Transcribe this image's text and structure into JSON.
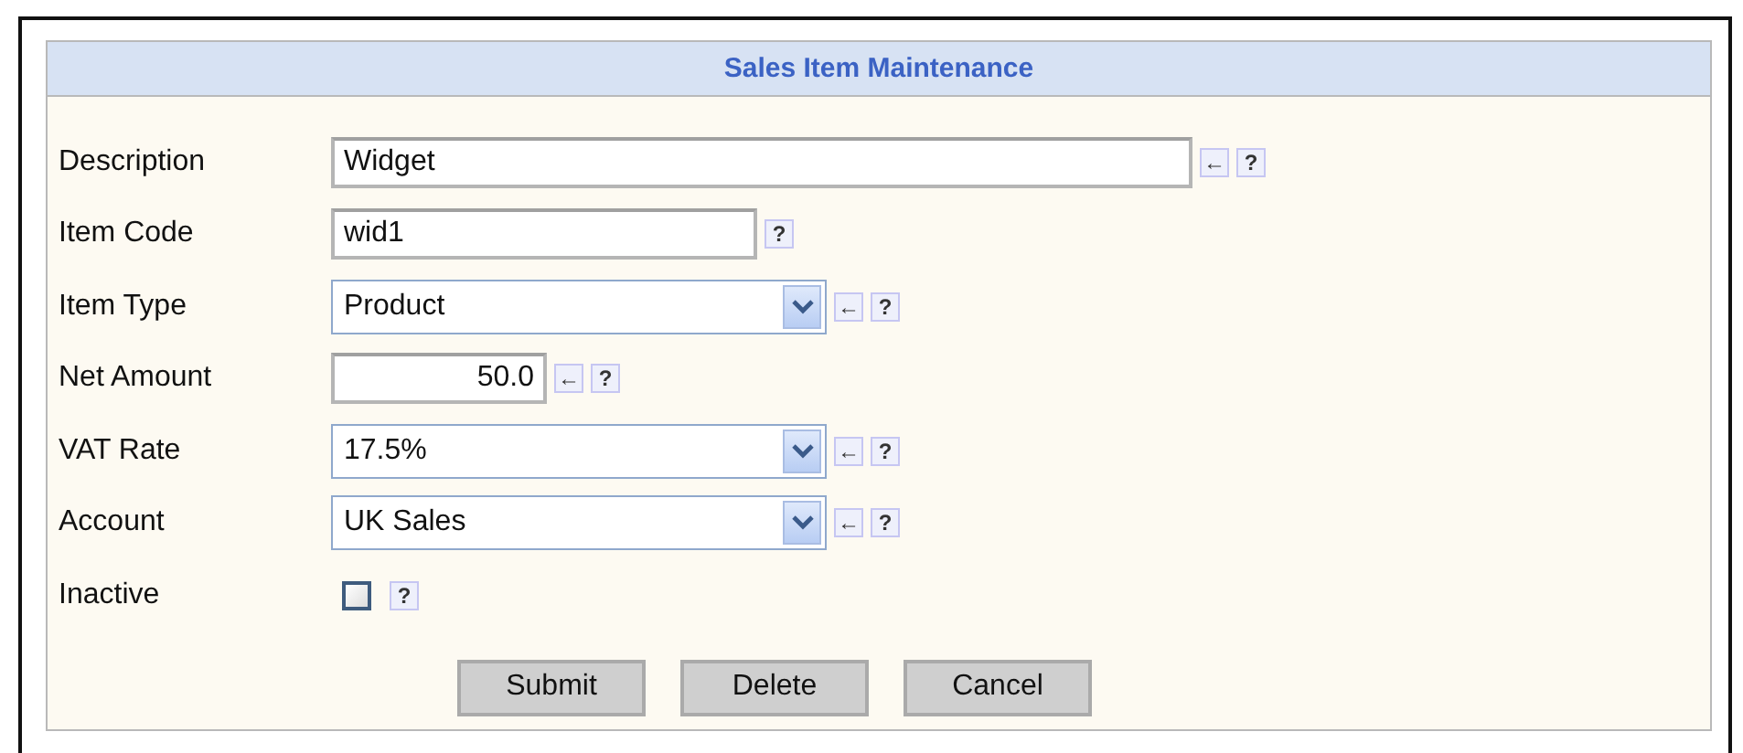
{
  "form": {
    "title": "Sales Item Maintenance",
    "fields": [
      {
        "label": "Description",
        "kind": "longtext",
        "value": "Widget",
        "reset": "←",
        "help": "?"
      },
      {
        "label": "Item Code",
        "kind": "text",
        "value": "wid1",
        "help": "?"
      },
      {
        "label": "Item Type",
        "kind": "select",
        "value": "Product",
        "reset": "←",
        "help": "?"
      },
      {
        "label": "Net Amount",
        "kind": "number",
        "value": "50.0",
        "reset": "←",
        "help": "?"
      },
      {
        "label": "VAT Rate",
        "kind": "select",
        "value": "17.5%",
        "reset": "←",
        "help": "?"
      },
      {
        "label": "Account",
        "kind": "select",
        "value": "UK Sales",
        "reset": "←",
        "help": "?"
      },
      {
        "label": "Inactive",
        "kind": "checkbox",
        "checked": false,
        "help": "?"
      }
    ],
    "buttons": [
      "Submit",
      "Delete",
      "Cancel"
    ]
  }
}
